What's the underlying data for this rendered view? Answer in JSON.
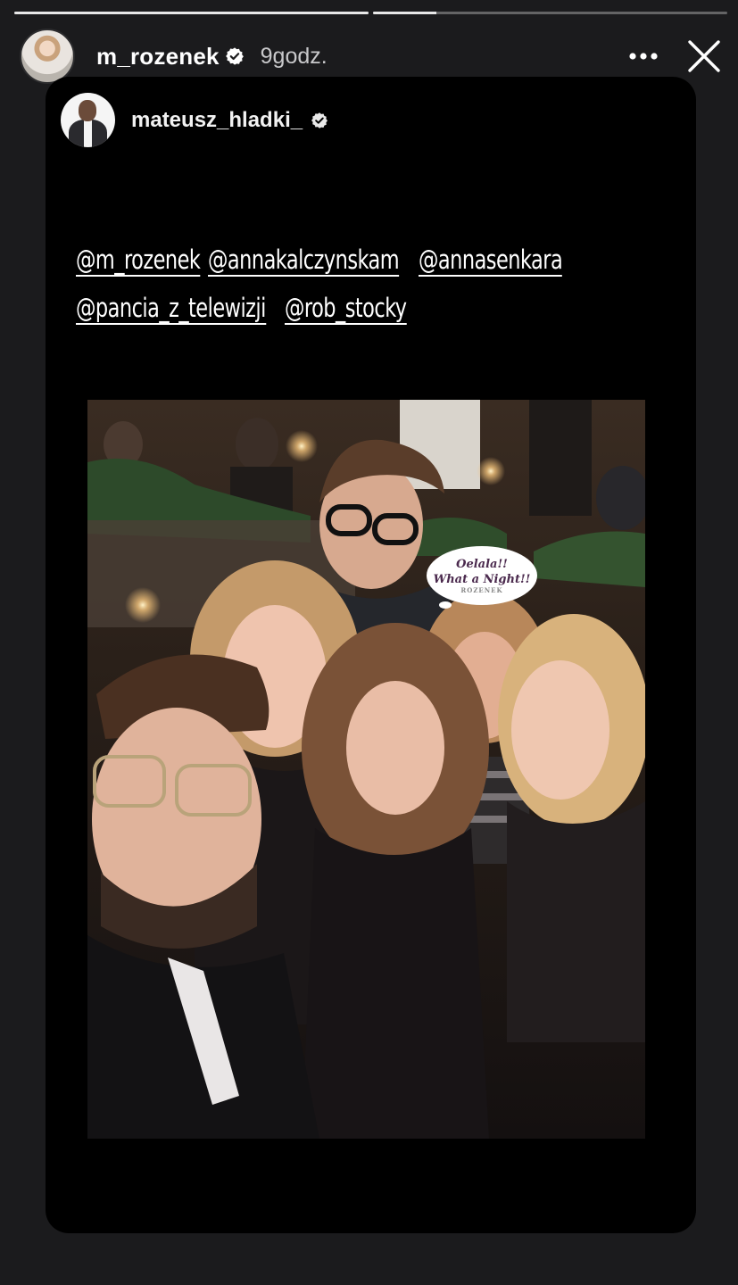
{
  "story": {
    "progress": [
      1.0,
      0.18
    ]
  },
  "header": {
    "username": "m_rozenek",
    "time_ago": "9godz.",
    "more_icon": "ellipsis-icon",
    "close_icon": "close-icon"
  },
  "shared_post": {
    "username": "mateusz_hladki_",
    "mentions_row1": [
      "@m_rozenek",
      "@annakalczynskam",
      "@annasenkara"
    ],
    "mentions_row2": [
      "@pancia_z_telewizji",
      "@rob_stocky"
    ],
    "sticker": {
      "line1": "Oelala!!",
      "line2": "What a Night!!",
      "brand": "ROZENEK"
    }
  },
  "colors": {
    "background": "#1b1b1d",
    "card": "#000000",
    "verified": "#ffffff"
  }
}
